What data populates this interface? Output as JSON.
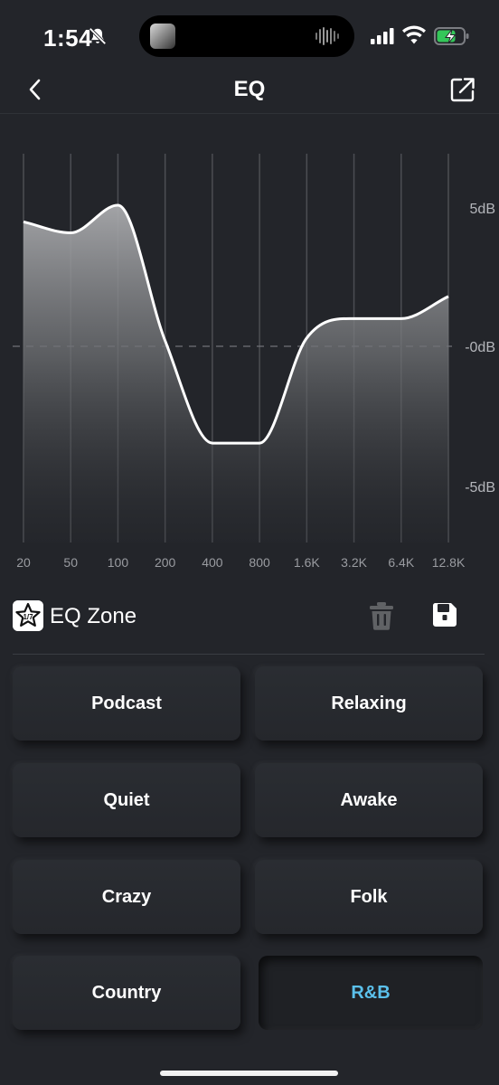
{
  "status_bar": {
    "time": "1:54",
    "icons": [
      "bell-slash-icon",
      "music-thumbnail-icon",
      "waveform-icon",
      "cellular-signal-icon",
      "wifi-icon",
      "battery-charging-icon"
    ],
    "battery_color": "#34c759"
  },
  "header": {
    "title": "EQ",
    "back_icon": "chevron-left-icon",
    "share_icon": "share-external-icon"
  },
  "chart_data": {
    "type": "area",
    "categories": [
      "20",
      "50",
      "100",
      "200",
      "400",
      "800",
      "1.6K",
      "3.2K",
      "6.4K",
      "12.8K"
    ],
    "values": [
      4.5,
      4.1,
      5.1,
      0.2,
      -3.5,
      -3.5,
      0.3,
      1.0,
      1.0,
      1.8
    ],
    "y_tick_labels": [
      "5dB",
      "-0dB",
      "-5dB"
    ],
    "ylim": [
      -5,
      5
    ],
    "grid": true,
    "zero_line": "dashed"
  },
  "zone": {
    "title": "EQ Zone",
    "logo_icon": "eq-zone-star-logo-icon",
    "delete_icon": "trash-icon",
    "save_icon": "floppy-disk-icon"
  },
  "presets": [
    {
      "label": "Podcast",
      "active": false
    },
    {
      "label": "Relaxing",
      "active": false
    },
    {
      "label": "Quiet",
      "active": false
    },
    {
      "label": "Awake",
      "active": false
    },
    {
      "label": "Crazy",
      "active": false
    },
    {
      "label": "Folk",
      "active": false
    },
    {
      "label": "Country",
      "active": false
    },
    {
      "label": "R&B",
      "active": true
    }
  ],
  "colors": {
    "background": "#23252a",
    "active_text": "#5bc0eb",
    "curve": "#ffffff"
  }
}
